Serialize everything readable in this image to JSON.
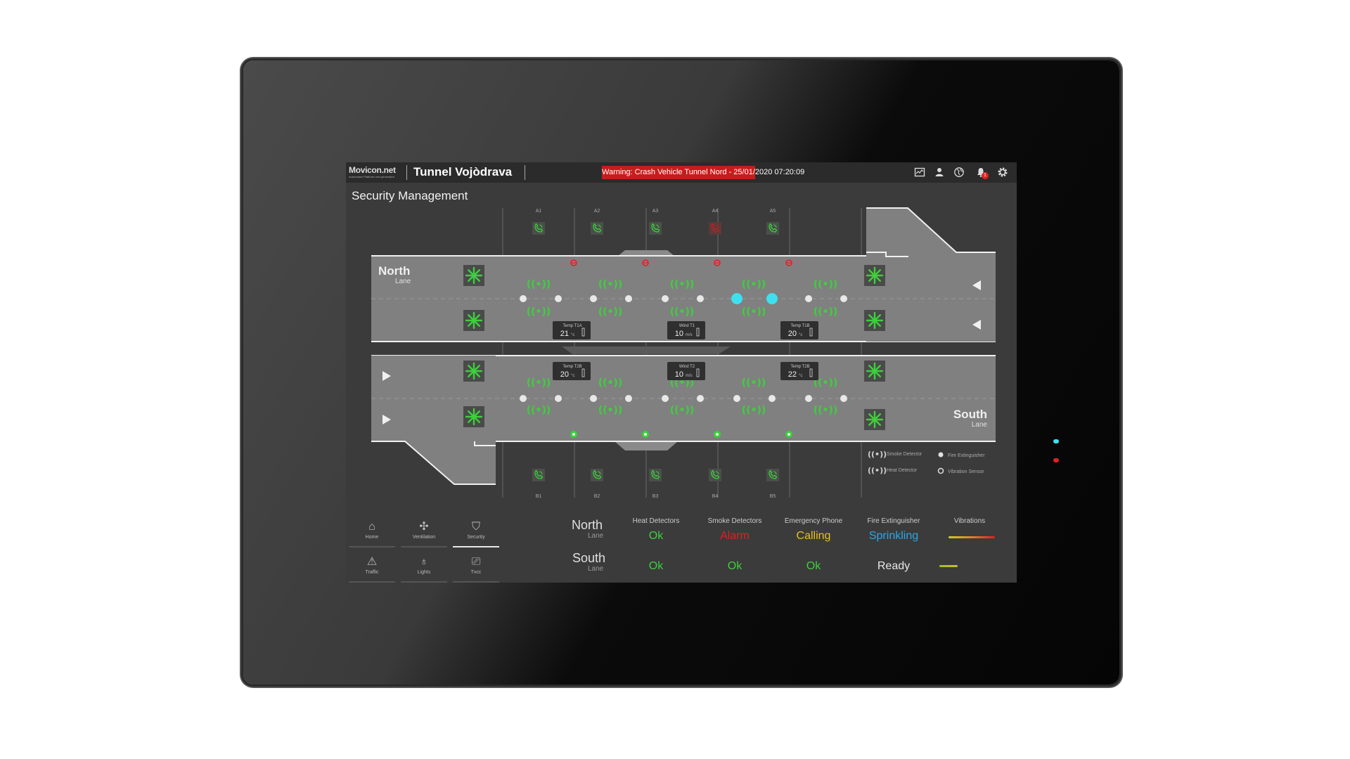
{
  "header": {
    "brand": "Movicon.net",
    "brand_sub": "Automation Platform.next generation",
    "app_title": "Tunnel Vojòdrava",
    "warning": "Warning: Crash Vehicle Tunnel Nord - 25/01/2020 07:20:09",
    "notification_count": "1",
    "icons": [
      "trend-icon",
      "user-icon",
      "globe-icon",
      "bell-icon",
      "gear-icon"
    ]
  },
  "page": {
    "title": "Security Management"
  },
  "tunnel": {
    "top_positions": [
      "A1",
      "A2",
      "A3",
      "A4",
      "A5"
    ],
    "bottom_positions": [
      "B1",
      "B2",
      "B3",
      "B4",
      "B5"
    ],
    "north_lane": {
      "name": "North",
      "sub": "Lane"
    },
    "south_lane": {
      "name": "South",
      "sub": "Lane"
    },
    "readouts": [
      {
        "label": "Temp T1A",
        "value": "21",
        "unit": "°c"
      },
      {
        "label": "Wind T1",
        "value": "10",
        "unit": "m/s"
      },
      {
        "label": "Temp T1B",
        "value": "20",
        "unit": "°c"
      },
      {
        "label": "Temp T2B",
        "value": "20",
        "unit": "°c"
      },
      {
        "label": "Wind T2",
        "value": "10",
        "unit": "m/s"
      },
      {
        "label": "Temp T2B",
        "value": "22",
        "unit": "°c"
      }
    ],
    "legend": {
      "smoke": "Smoke Detector",
      "heat": "Heat Detector",
      "fire": "Fire Extinguisher",
      "vibration": "Vibration Sensor"
    },
    "colors": {
      "ok": "#3bd13b",
      "alarm": "#e02020",
      "active": "#3ee0f0"
    }
  },
  "nav": [
    {
      "label": "Home",
      "icon": "home-icon",
      "active": false
    },
    {
      "label": "Ventilation",
      "icon": "fan-icon",
      "active": false
    },
    {
      "label": "Security",
      "icon": "shield-icon",
      "active": true
    },
    {
      "label": "Traffic",
      "icon": "traffic-cone-icon",
      "active": false
    },
    {
      "label": "Lights",
      "icon": "bulb-icon",
      "active": false
    },
    {
      "label": "Tvcc",
      "icon": "camera-icon",
      "active": false
    }
  ],
  "status": {
    "columns": [
      "Heat Detectors",
      "Smoke Detectors",
      "Emergency Phone",
      "Fire Extinguisher",
      "Vibrations"
    ],
    "north": {
      "name": "North",
      "sub": "Lane",
      "values": [
        "Ok",
        "Alarm",
        "Calling",
        "Sprinkling"
      ]
    },
    "south": {
      "name": "South",
      "sub": "Lane",
      "values": [
        "Ok",
        "Ok",
        "Ok",
        "Ready"
      ]
    },
    "colors": {
      "ok": "#3bd13b",
      "alarm": "#e02020",
      "calling": "#e8c020",
      "sprinkling": "#2aa8e8",
      "ready": "#e8e8e8"
    }
  }
}
